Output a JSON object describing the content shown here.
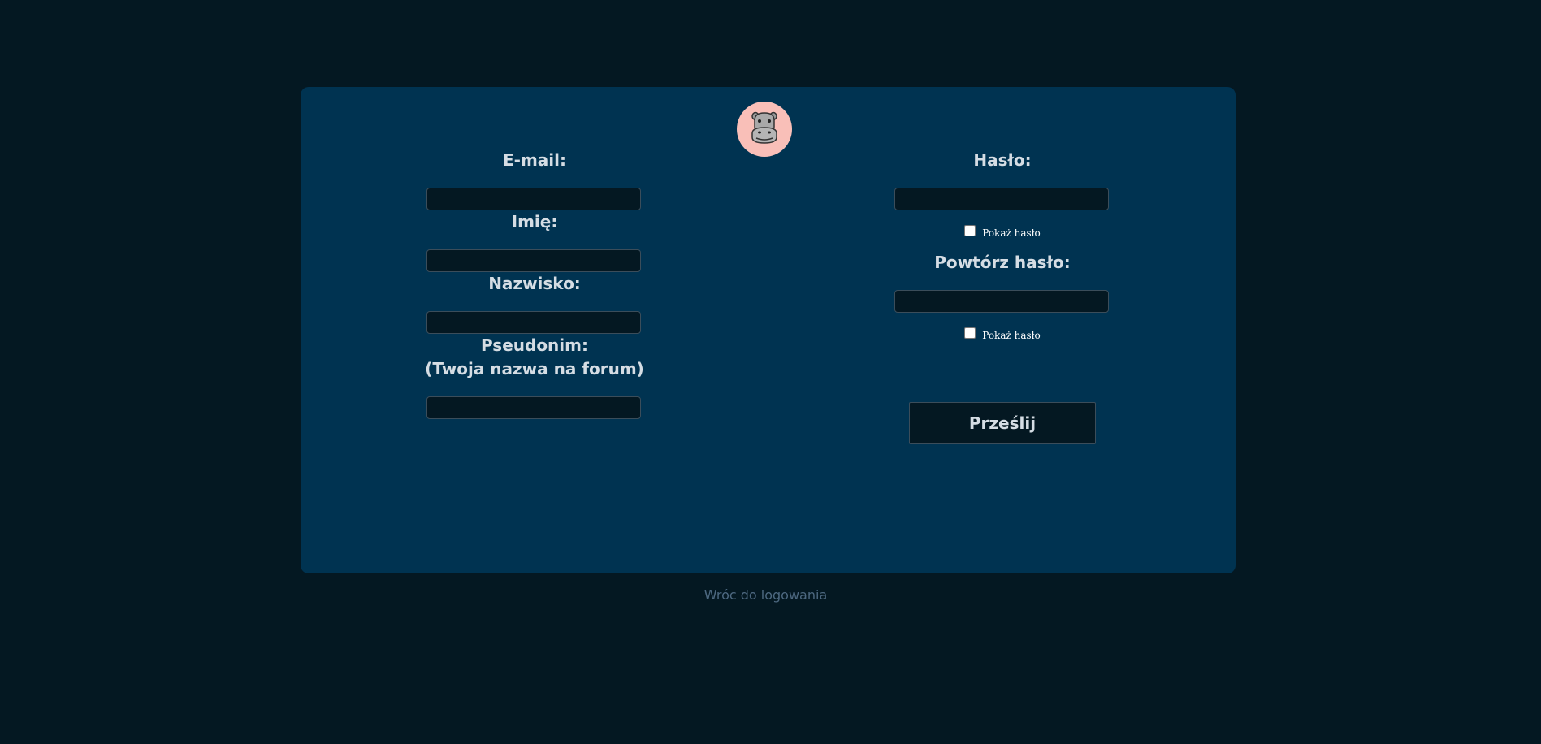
{
  "form": {
    "left": {
      "email_label": "E-mail:",
      "email_value": "",
      "first_name_label": "Imię:",
      "first_name_value": "",
      "last_name_label": "Nazwisko:",
      "last_name_value": "",
      "nickname_label": "Pseudonim:",
      "nickname_hint": "(Twoja nazwa na forum)",
      "nickname_value": ""
    },
    "right": {
      "password_label": "Hasło:",
      "password_value": "",
      "show_password_label": "Pokaż hasło",
      "show_password_checked": false,
      "repeat_password_label": "Powtórz hasło:",
      "repeat_password_value": "",
      "show_repeat_password_label": "Pokaż hasło",
      "show_repeat_password_checked": false,
      "submit_label": "Prześlij"
    }
  },
  "logo_icon": "hippo-icon",
  "back_link_label": "Wróc do logowania",
  "colors": {
    "page_background": "#041822",
    "card_background": "#003351",
    "logo_background": "#f9bfb8",
    "input_background": "#041822",
    "label_text": "#d5dde4",
    "link_text": "#4d6880"
  }
}
